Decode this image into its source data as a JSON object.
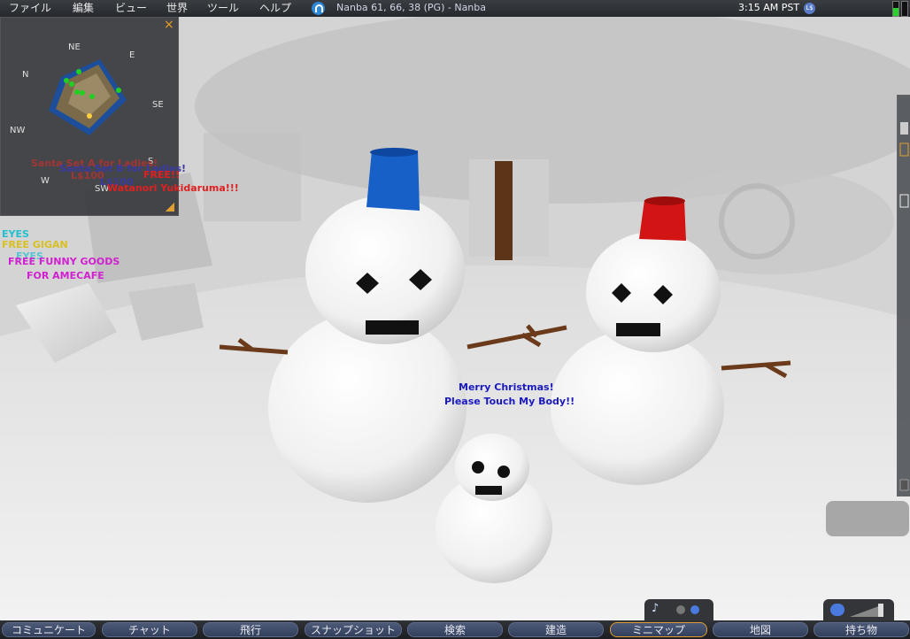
{
  "menubar": {
    "items": [
      "ファイル",
      "編集",
      "ビュー",
      "世界",
      "ツール",
      "ヘルプ"
    ],
    "location": "Nanba 61, 66, 38 (PG) - Nanba",
    "clock": "3:15 AM PST",
    "ls_icon": "L$",
    "bandwidth_level": 0.55
  },
  "minimap": {
    "compass": {
      "n": "N",
      "ne": "NE",
      "e": "E",
      "se": "SE",
      "s": "S",
      "sw": "SW",
      "w": "W",
      "nw": "NW"
    },
    "close_icon": "×"
  },
  "scene_labels": {
    "santa_a": "Santa Set A for Ladies!",
    "santa_a_price": "L$100",
    "santa_b": "Santa Set B for Ladies!",
    "santa_b_price": "L$100",
    "free": "FREE!!",
    "watanori": "Watanori Yukidaruma!!!",
    "eyes1": "EYES",
    "free_gigan": "FREE GIGAN",
    "eyes2": "EYES",
    "free_funny": "FREE FUNNY GOODS",
    "for_amecafe": "FOR AMECAFE",
    "merry1": "Merry Christmas!",
    "merry2": "Please Touch My Body!!"
  },
  "toolbar": {
    "buttons": [
      "コミュニケート",
      "チャット",
      "飛行",
      "スナップショット",
      "検索",
      "建造",
      "ミニマップ",
      "地図",
      "持ち物"
    ],
    "active": "ミニマップ"
  },
  "colors": {
    "blue_bucket": "#1660c8",
    "red_bucket": "#d21414",
    "stick": "#6a3a1a",
    "label_blue": "#1a1ac0",
    "label_red": "#e02020",
    "label_magenta": "#d020d0",
    "label_yellow": "#d8c020",
    "label_cyan": "#20c0d0"
  }
}
